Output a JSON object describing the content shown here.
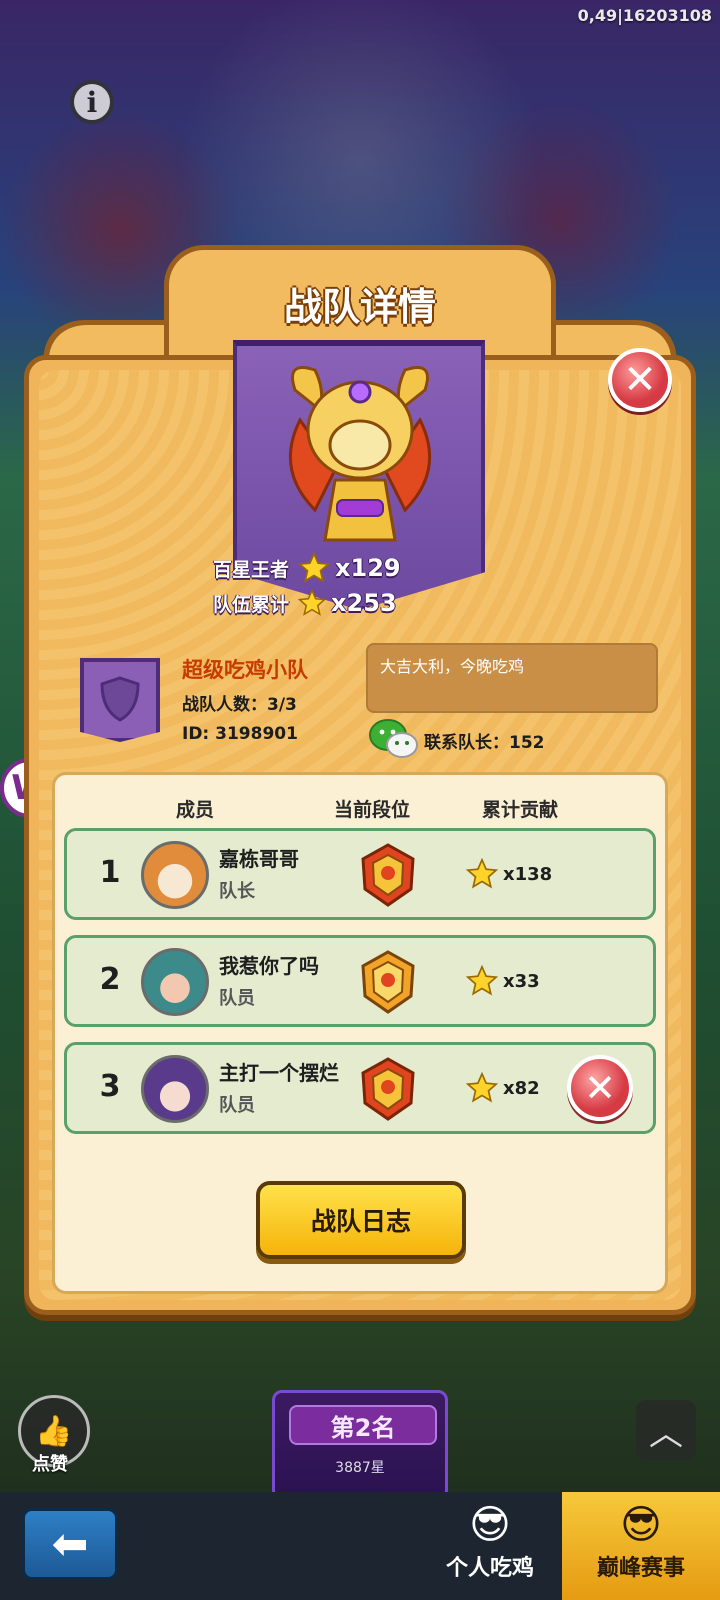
{
  "overlay_code": "0,49|16203108",
  "panel": {
    "title": "战队详情",
    "stats": [
      {
        "label": "百星王者",
        "value": "x129"
      },
      {
        "label": "队伍累计",
        "value": "x253"
      }
    ]
  },
  "team": {
    "name": "超级吃鸡小队",
    "count": "战队人数：3/3",
    "id": "ID: 3198901",
    "motto": "大吉大利，今晚吃鸡",
    "contact": "联系队长：152"
  },
  "columns": [
    "成员",
    "当前段位",
    "累计贡献"
  ],
  "members": [
    {
      "num": "1",
      "name": "嘉栋哥哥",
      "role": "队长",
      "contribution": "x138"
    },
    {
      "num": "2",
      "name": "我惹你了吗",
      "role": "队员",
      "contribution": "x33"
    },
    {
      "num": "3",
      "name": "主打一个摆烂",
      "role": "队员",
      "contribution": "x82"
    }
  ],
  "buttons": {
    "log": "战队日志",
    "like": "点赞"
  },
  "background": {
    "rank_title": "第2名",
    "rank_stars": "3887星"
  },
  "tabs": {
    "personal": "个人吃鸡",
    "peak": "巅峰赛事"
  },
  "icons": [
    "info-icon",
    "close-icon",
    "star-icon",
    "wechat-icon",
    "thumbs-up-icon",
    "back-arrow-icon",
    "chevron-up-icon",
    "kick-icon"
  ],
  "colors": {
    "panel": "#f0b45a",
    "banner": "#6d49a0",
    "row_border": "#5aa06a",
    "log_button": "#f5b40a",
    "close_red": "#d63b44"
  }
}
